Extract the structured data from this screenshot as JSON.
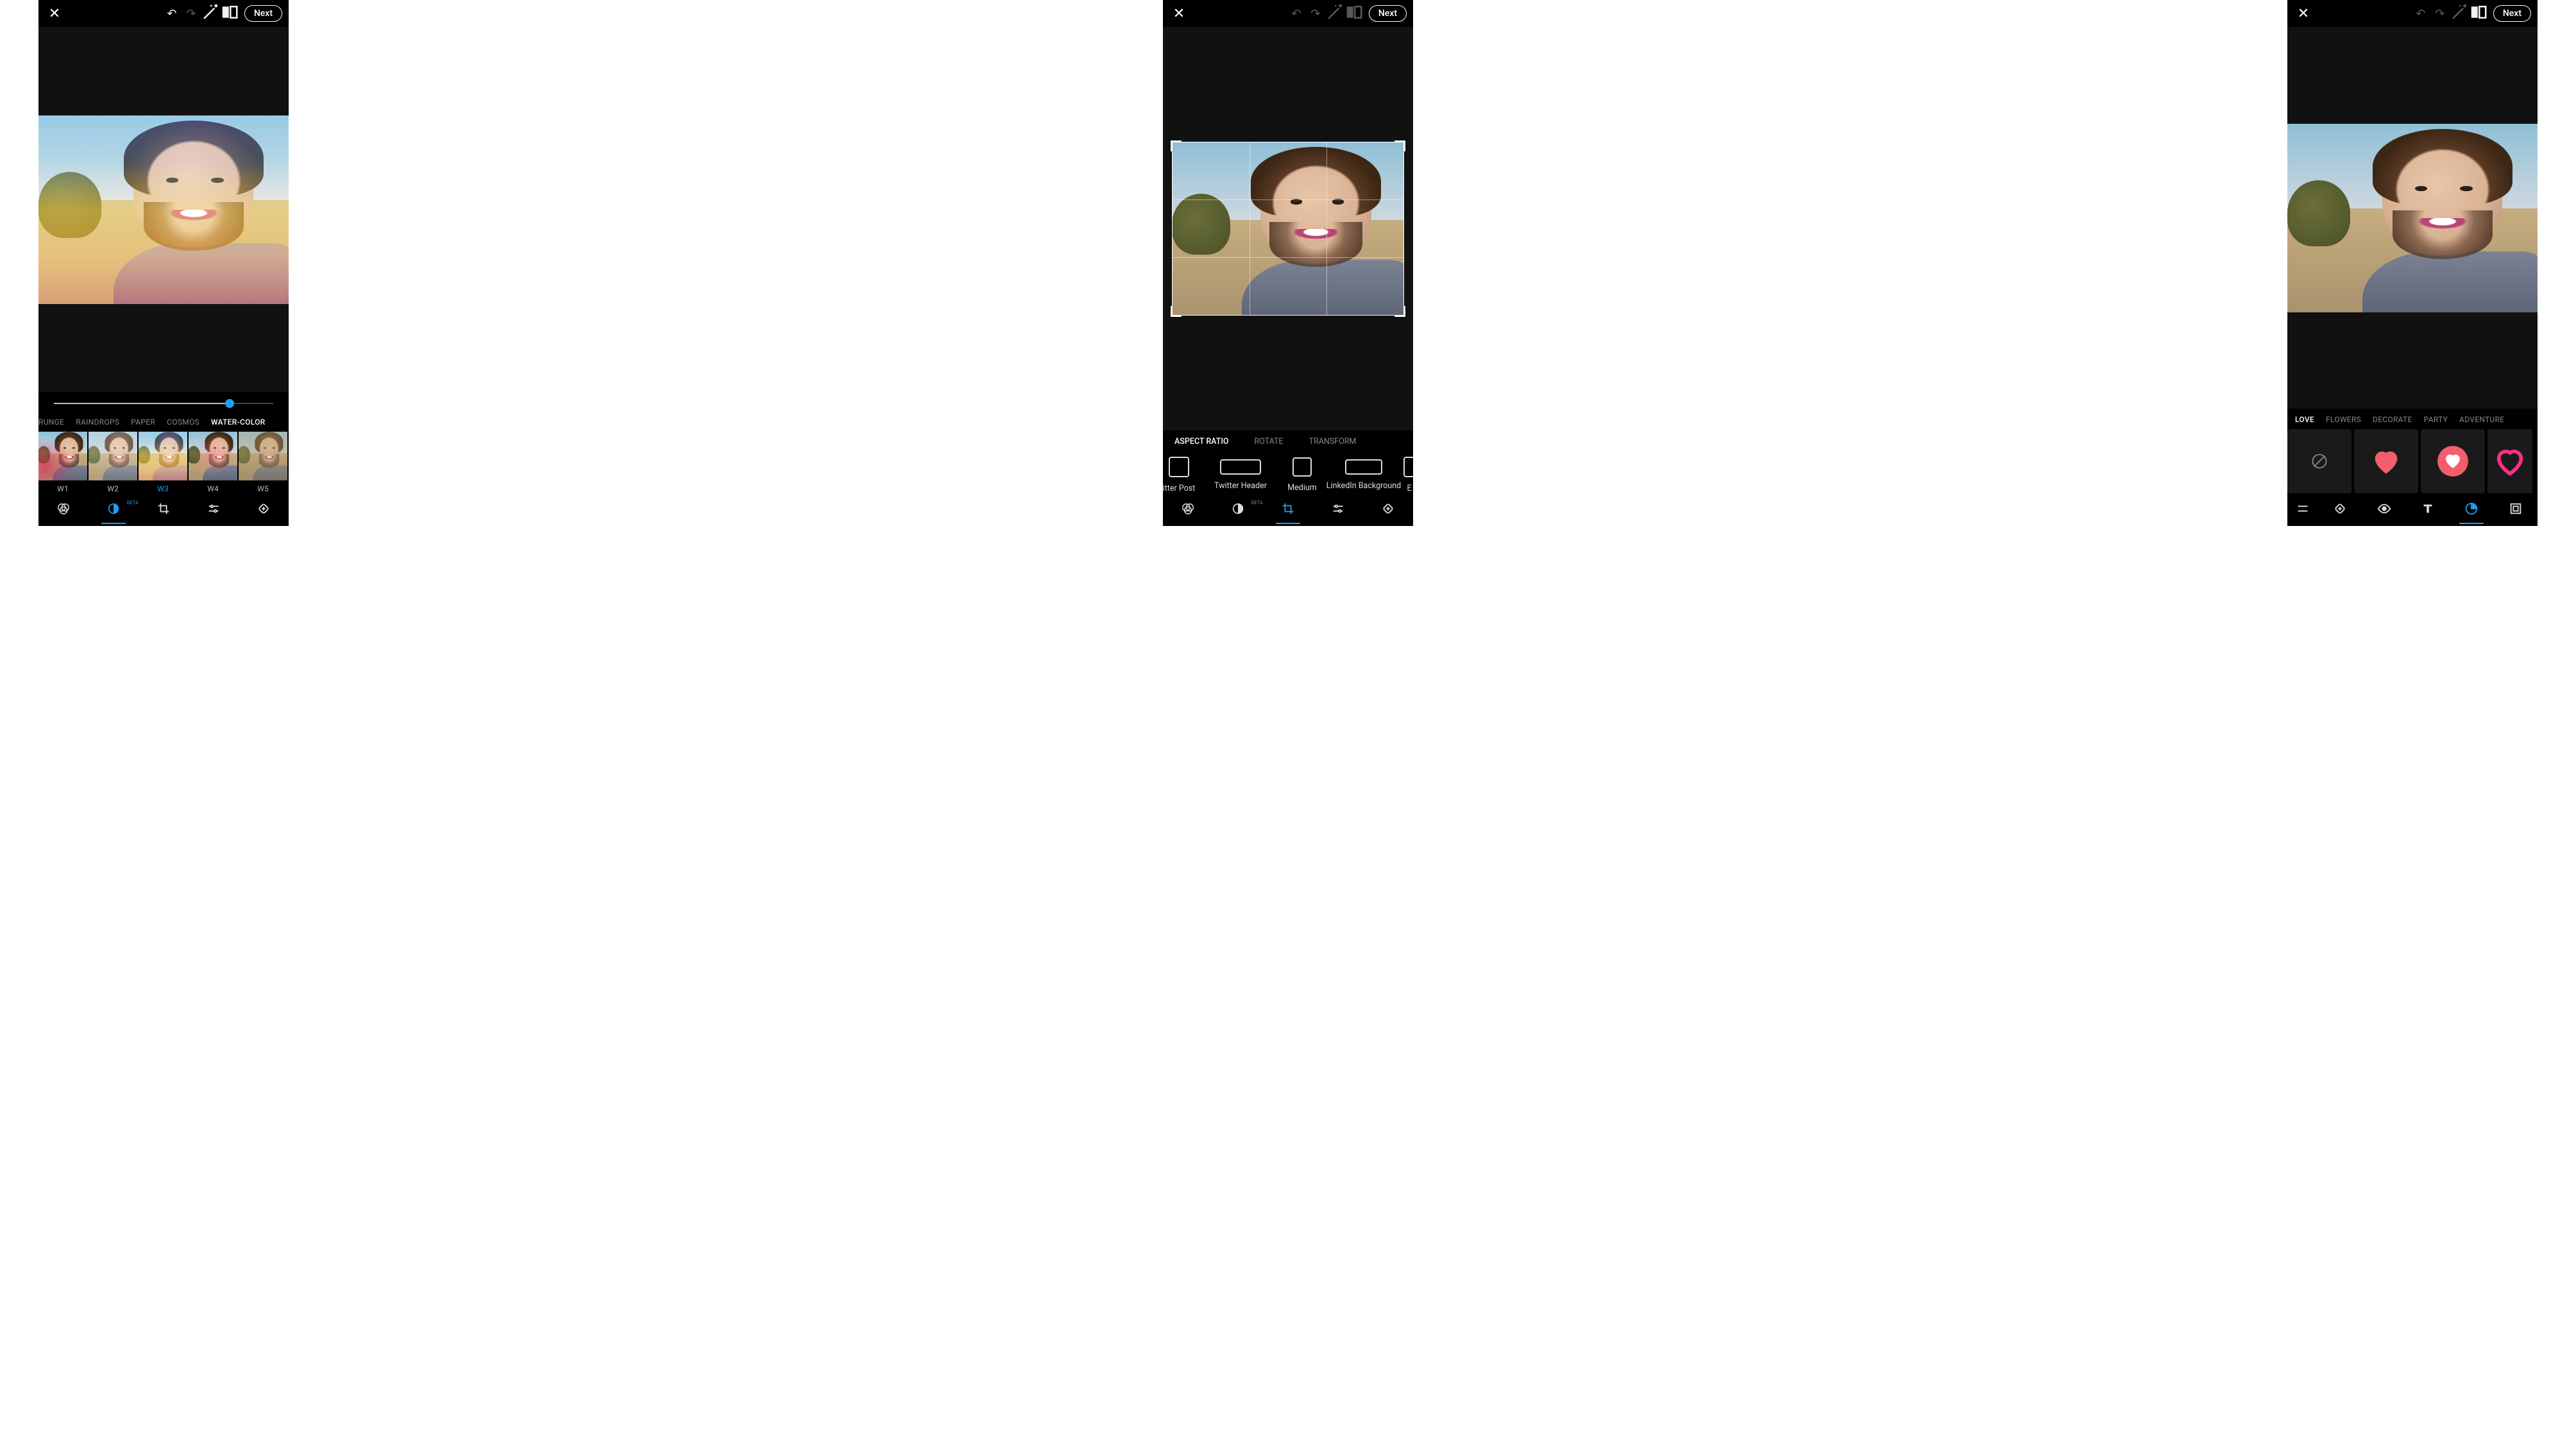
{
  "toolbar": {
    "close_icon": "close",
    "undo_icon": "undo",
    "redo_icon": "redo",
    "wand_icon": "magic-wand",
    "compare_icon": "compare",
    "next_label": "Next"
  },
  "screen1": {
    "slider_percent": 80,
    "categories": [
      "RUNGE",
      "RAINDROPS",
      "PAPER",
      "COSMOS",
      "WATER-COLOR"
    ],
    "active_category": "WATER-COLOR",
    "filters": [
      {
        "id": "W1",
        "label": "W1",
        "overlay": "w1"
      },
      {
        "id": "W2",
        "label": "W2",
        "overlay": "w2"
      },
      {
        "id": "W3",
        "label": "W3",
        "overlay": "watercolor"
      },
      {
        "id": "W4",
        "label": "W4",
        "overlay": "w4"
      },
      {
        "id": "W5",
        "label": "W5",
        "overlay": "w5"
      }
    ],
    "selected_filter": "W3",
    "nav": [
      "filters",
      "effects",
      "crop",
      "adjust",
      "heal"
    ],
    "active_nav": "effects",
    "beta_label": "BETA"
  },
  "screen2": {
    "sub_tabs": [
      "ASPECT RATIO",
      "ROTATE",
      "TRANSFORM"
    ],
    "active_sub_tab": "ASPECT RATIO",
    "presets": [
      {
        "label": "Twitter Post",
        "w": 28,
        "h": 28,
        "display": "itter Post"
      },
      {
        "label": "Twitter Header",
        "w": 60,
        "h": 20
      },
      {
        "label": "Medium",
        "w": 26,
        "h": 26
      },
      {
        "label": "LinkedIn Background",
        "w": 54,
        "h": 20
      },
      {
        "label": "E",
        "w": 20,
        "h": 20,
        "display": "E"
      }
    ],
    "nav": [
      "filters",
      "effects",
      "crop",
      "adjust",
      "heal"
    ],
    "active_nav": "crop",
    "beta_label": "BETA"
  },
  "screen3": {
    "categories": [
      "LOVE",
      "FLOWERS",
      "DECORATE",
      "PARTY",
      "ADVENTURE"
    ],
    "active_category": "LOVE",
    "stickers": [
      "none",
      "heart-solid",
      "heart-badge",
      "heart-outline"
    ],
    "nav": [
      "crop-partial",
      "heal",
      "eye",
      "text",
      "sticker",
      "frame"
    ],
    "active_nav": "sticker"
  },
  "colors": {
    "accent": "#1e9df1",
    "heart": "#f45d6b",
    "pink": "#ff2e88"
  }
}
